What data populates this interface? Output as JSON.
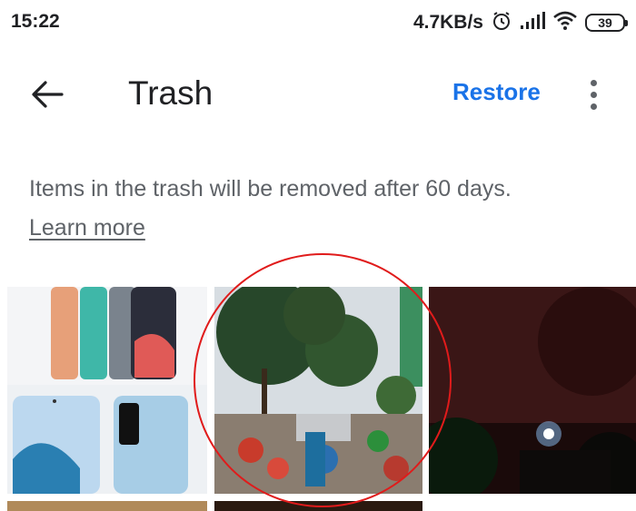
{
  "status_bar": {
    "time": "15:22",
    "network_speed": "4.7KB/s",
    "battery_level": "39",
    "icons": [
      "alarm-icon",
      "signal-icon",
      "wifi-icon",
      "battery-icon"
    ]
  },
  "app_bar": {
    "back_icon": "arrow-left-icon",
    "title": "Trash",
    "restore_label": "Restore",
    "more_icon": "more-vert-icon"
  },
  "notice": {
    "text": "Items in the trash will be removed after 60 days.",
    "link_label": "Learn more"
  },
  "grid": {
    "items": [
      {
        "name": "phones-photo"
      },
      {
        "name": "outdoor-crowd-photo"
      },
      {
        "name": "night-sky-photo"
      },
      {
        "name": "street-photo"
      },
      {
        "name": "dark-photo"
      }
    ]
  },
  "colors": {
    "accent": "#1a73e8",
    "annotation": "#e01b1b"
  }
}
